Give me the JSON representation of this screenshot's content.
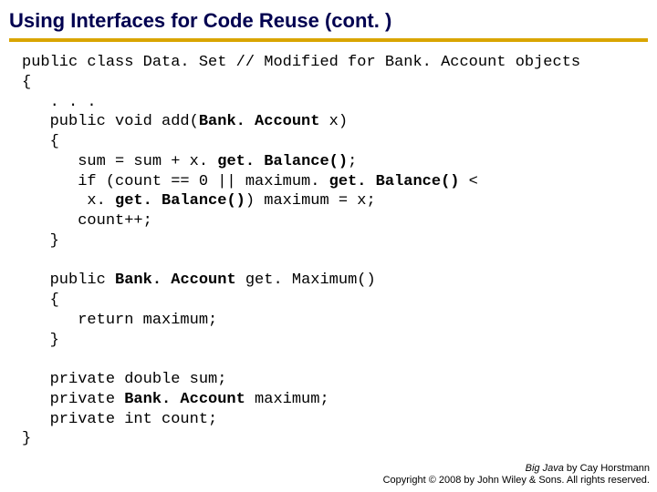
{
  "title": "Using Interfaces for Code Reuse  (cont. )",
  "code": {
    "l01a": "public class Data. Set // Modified for Bank. Account objects",
    "l02": "{",
    "l03": "   . . .",
    "l04a": "   public void add(",
    "l04b": "Bank. Account",
    "l04c": " x)",
    "l05": "   {",
    "l06a": "      sum = sum + x. ",
    "l06b": "get. Balance()",
    "l06c": ";",
    "l07a": "      if (count == 0 || maximum. ",
    "l07b": "get. Balance()",
    "l07c": " < ",
    "l08a": "       x. ",
    "l08b": "get. Balance()",
    "l08c": ") maximum = x;",
    "l09": "      count++;",
    "l10": "   }",
    "blank1": "",
    "l11a": "   public ",
    "l11b": "Bank. Account",
    "l11c": " get. Maximum()",
    "l12": "   {",
    "l13": "      return maximum;",
    "l14": "   }",
    "blank2": "",
    "l15": "   private double sum;",
    "l16a": "   private ",
    "l16b": "Bank. Account",
    "l16c": " maximum;",
    "l17": "   private int count;",
    "l18": "}"
  },
  "footer": {
    "book": "Big Java",
    "by": " by Cay Horstmann",
    "copyright": "Copyright © 2008 by John Wiley & Sons.  All rights reserved."
  }
}
